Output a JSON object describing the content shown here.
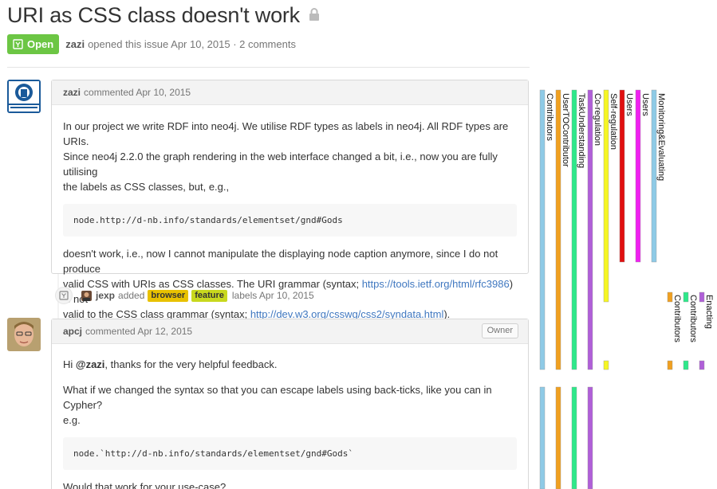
{
  "issue": {
    "title": "URI as CSS class doesn't work",
    "state": "Open",
    "author": "zazi",
    "opened_text": "opened this issue Apr 10, 2015 · 2 comments"
  },
  "comments": [
    {
      "author": "zazi",
      "header_text": "commented Apr 10, 2015",
      "body": {
        "p1": "In our project we write RDF into neo4j. We utilise RDF types as labels in neo4j. All RDF types are URIs.",
        "p2": "Since neo4j 2.2.0 the graph rendering in the web interface changed a bit, i.e., now you are fully utilising",
        "p3": "the labels as CSS classes, but, e.g.,",
        "code": "node.http://d-nb.info/standards/elementset/gnd#Gods",
        "p4": "doesn't work, i.e., now I cannot manipulate the displaying node caption anymore, since I do not produce",
        "p5a": "valid CSS with URIs as CSS classes. The URI grammar (syntax; ",
        "link1": "https://tools.ietf.org/html/rfc3986",
        "p5b": ") is not",
        "p6a": "valid to the CSS class grammar (syntax; ",
        "link2": "http://dev.w3.org/csswg/css2/syndata.html",
        "p6b": ")."
      }
    },
    {
      "author": "apcj",
      "header_text": "commented Apr 12, 2015",
      "badge": "Owner",
      "body": {
        "p1a": "Hi ",
        "mention": "@zazi",
        "p1b": ", thanks for the very helpful feedback.",
        "p2": "What if we changed the syntax so that you can escape labels using back-ticks, like you can in Cypher?",
        "p3": "e.g.",
        "code": "node.`http://d-nb.info/standards/elementset/gnd#Gods`",
        "p4": "Would that work for your use-case?"
      }
    }
  ],
  "label_event": {
    "actor": "jexp",
    "added": "added",
    "labels": [
      {
        "name": "browser",
        "color": "#e8c100"
      },
      {
        "name": "feature",
        "color": "#c8d81e"
      }
    ],
    "suffix": "labels Apr 10, 2015"
  },
  "right_panel_bars": [
    {
      "label": "Contributors",
      "color": "#8ecae6"
    },
    {
      "label": "UserTOContributor",
      "color": "#f0a020"
    },
    {
      "label": "TaskUnderstanding",
      "color": "#2ee88a"
    },
    {
      "label": "Co-regulation",
      "color": "#b05fd8"
    },
    {
      "label": "Self-regulation",
      "color": "#f5f523"
    },
    {
      "label": "Users",
      "color": "#e01010"
    },
    {
      "label": "Users",
      "color": "#f020f0"
    },
    {
      "label": "Monitoring&Evaluating",
      "color": "#8ecae6"
    },
    {
      "label": "Contributors",
      "color": "#f0a020"
    },
    {
      "label": "Contributors",
      "color": "#2ee88a"
    },
    {
      "label": "Enacting",
      "color": "#b05fd8"
    }
  ]
}
